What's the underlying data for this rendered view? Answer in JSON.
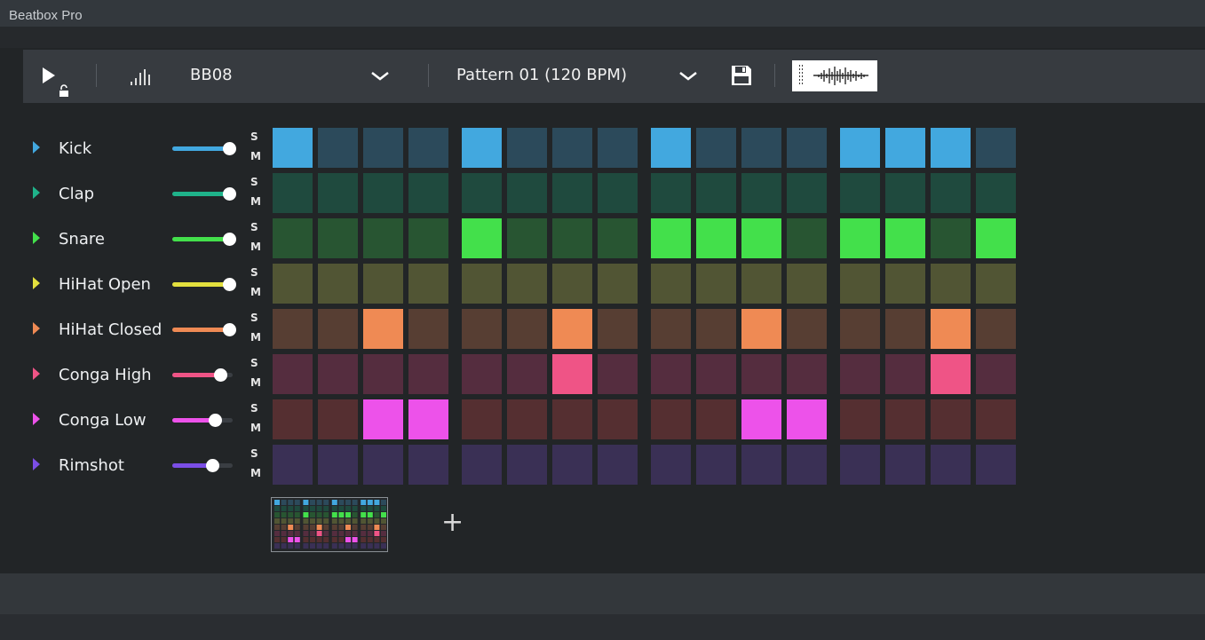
{
  "window": {
    "title": "Beatbox Pro"
  },
  "toolbar": {
    "kit_name": "BB08",
    "pattern_name": "Pattern 01 (120 BPM)"
  },
  "step_labels": {
    "solo": "S",
    "mute": "M"
  },
  "tracks": [
    {
      "name": "Kick",
      "color": "#42a8df",
      "off_color": "#2c4a5b",
      "volume": 1.0,
      "steps": [
        1,
        0,
        0,
        0,
        1,
        0,
        0,
        0,
        1,
        0,
        0,
        0,
        1,
        1,
        1,
        0
      ]
    },
    {
      "name": "Clap",
      "color": "#1fb38a",
      "off_color": "#1f4a3e",
      "volume": 1.0,
      "steps": [
        0,
        0,
        0,
        0,
        0,
        0,
        0,
        0,
        0,
        0,
        0,
        0,
        0,
        0,
        0,
        0
      ]
    },
    {
      "name": "Snare",
      "color": "#43e04b",
      "off_color": "#285532",
      "volume": 1.0,
      "steps": [
        0,
        0,
        0,
        0,
        1,
        0,
        0,
        0,
        1,
        1,
        1,
        0,
        1,
        1,
        0,
        1
      ]
    },
    {
      "name": "HiHat Open",
      "color": "#e3e03e",
      "off_color": "#515534",
      "volume": 1.0,
      "steps": [
        0,
        0,
        0,
        0,
        0,
        0,
        0,
        0,
        0,
        0,
        0,
        0,
        0,
        0,
        0,
        0
      ]
    },
    {
      "name": "HiHat Closed",
      "color": "#ef8a54",
      "off_color": "#573e33",
      "volume": 1.0,
      "steps": [
        0,
        0,
        1,
        0,
        0,
        0,
        1,
        0,
        0,
        0,
        1,
        0,
        0,
        0,
        1,
        0
      ]
    },
    {
      "name": "Conga High",
      "color": "#ef5486",
      "off_color": "#552d3f",
      "volume": 0.85,
      "steps": [
        0,
        0,
        0,
        0,
        0,
        0,
        1,
        0,
        0,
        0,
        0,
        0,
        0,
        0,
        1,
        0
      ]
    },
    {
      "name": "Conga Low",
      "color": "#ed52ea",
      "off_color": "#552f31",
      "volume": 0.75,
      "steps": [
        0,
        0,
        1,
        1,
        0,
        0,
        0,
        0,
        0,
        0,
        1,
        1,
        0,
        0,
        0,
        0
      ]
    },
    {
      "name": "Rimshot",
      "color": "#7b4ee6",
      "off_color": "#3a3055",
      "volume": 0.7,
      "steps": [
        0,
        0,
        0,
        0,
        0,
        0,
        0,
        0,
        0,
        0,
        0,
        0,
        0,
        0,
        0,
        0
      ]
    }
  ],
  "add_pattern": {
    "label": "+"
  },
  "icons": {
    "play": "play-icon",
    "lock": "lock-icon",
    "kit": "bars-icon",
    "kit_dropdown": "chevron-down-icon",
    "pattern_dropdown": "chevron-down-icon",
    "save": "save-icon",
    "waveform": "waveform-icon"
  }
}
